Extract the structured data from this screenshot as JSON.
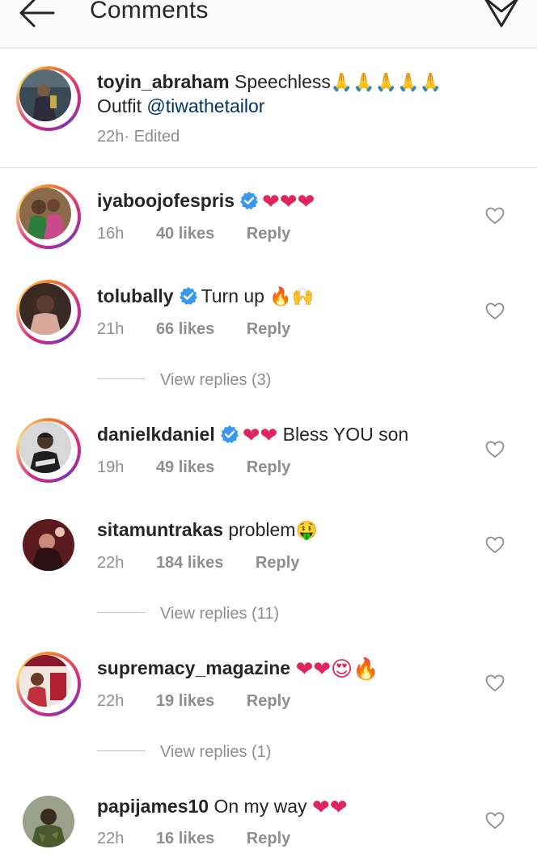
{
  "header": {
    "title": "Comments"
  },
  "caption": {
    "username": "toyin_abraham",
    "text": "Speechless",
    "emojis": "🙏🙏🙏🙏🙏",
    "line2_prefix": "Outfit ",
    "mention": "@tiwathetailor",
    "time": "22h",
    "edited": " · Edited"
  },
  "comments": [
    {
      "username": "iyaboojofespris",
      "verified": true,
      "text": "",
      "emojis": "❤❤❤",
      "time": "16h",
      "likes": "40 likes",
      "reply": "Reply"
    },
    {
      "username": "tolubally",
      "verified": true,
      "text": "Turn up ",
      "emojis": "🔥🙌",
      "time": "21h",
      "likes": "66 likes",
      "reply": "Reply",
      "view_replies": "View replies (3)"
    },
    {
      "username": "danielkdaniel",
      "verified": true,
      "text": "",
      "emojis": "❤❤",
      "text_after": " Bless YOU son",
      "time": "19h",
      "likes": "49 likes",
      "reply": "Reply"
    },
    {
      "username": "sitamuntrakas",
      "verified": false,
      "text": " problem",
      "emojis": "🤑",
      "time": "22h",
      "likes": "184 likes",
      "reply": "Reply",
      "view_replies": "View replies (11)"
    },
    {
      "username": "supremacy_magazine",
      "verified": false,
      "text": " ",
      "emojis": "❤❤😍🔥",
      "time": "22h",
      "likes": "19 likes",
      "reply": "Reply",
      "view_replies": "View replies (1)"
    },
    {
      "username": "papijames10",
      "verified": false,
      "text": " On my way ",
      "emojis": "❤❤",
      "time": "22h",
      "likes": "16 likes",
      "reply": "Reply"
    }
  ],
  "colors": {
    "link": "#003569",
    "muted": "#8e8e8e",
    "verified": "#3897f0",
    "heart": "#e0245e"
  },
  "icons": {
    "back": "arrow-left-icon",
    "send": "paper-plane-icon",
    "like": "heart-outline-icon",
    "verified": "verified-badge-icon"
  }
}
